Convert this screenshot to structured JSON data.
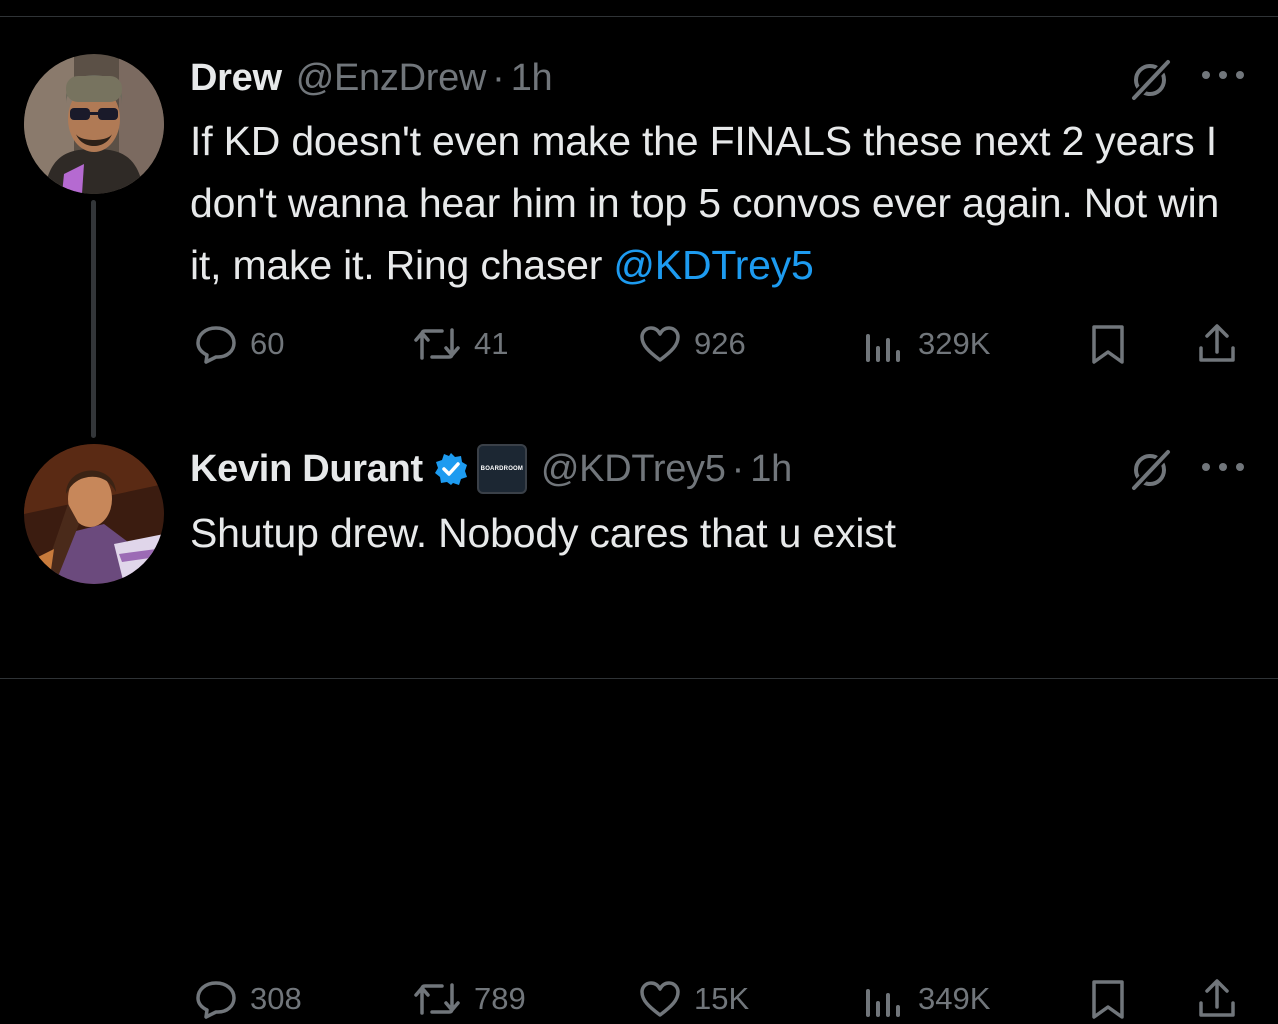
{
  "tweets": [
    {
      "name": "Drew",
      "handle": "@EnzDrew",
      "separator": "·",
      "time": "1h",
      "text_before": "If KD doesn't even make the FINALS these next 2 years I don't wanna hear him in top 5 convos ever again. Not win it, make it. Ring chaser ",
      "mention": "@KDTrey5",
      "replies": "60",
      "reposts": "41",
      "likes": "926",
      "views": "329K"
    },
    {
      "name": "Kevin Durant",
      "handle": "@KDTrey5",
      "separator": "·",
      "time": "1h",
      "affiliate_label": "BOARDROOM",
      "text_before": "Shutup drew. Nobody cares that u exist",
      "replies": "308",
      "reposts": "789",
      "likes": "15K",
      "views": "349K"
    }
  ],
  "colors": {
    "background": "#000000",
    "text": "#e7e9ea",
    "secondary": "#71767b",
    "mention": "#1d9bf0",
    "verified": "#1d9bf0",
    "divider": "#2f3336"
  },
  "icons": [
    "grok-icon",
    "more-icon",
    "reply-icon",
    "repost-icon",
    "like-icon",
    "views-icon",
    "bookmark-icon",
    "share-icon",
    "verified-badge-icon"
  ]
}
